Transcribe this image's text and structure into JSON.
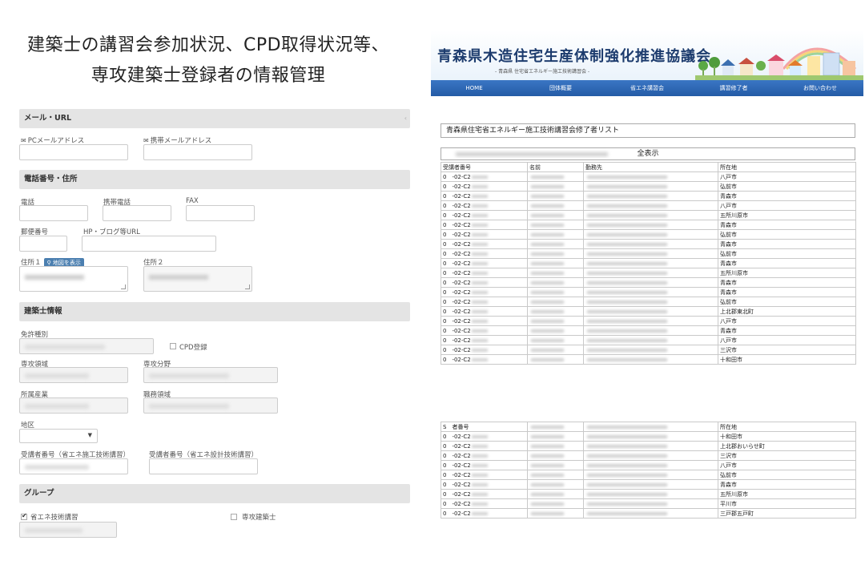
{
  "headline": {
    "line1": "建築士の講習会参加状況、CPD取得状況等、",
    "line2": "専攻建築士登録者の情報管理"
  },
  "form": {
    "mail_section": "メール・URL",
    "pc_mail": "PCメールアドレス",
    "mobile_mail": "携帯メールアドレス",
    "phone_section": "電話番号・住所",
    "tel": "電話",
    "mobile_tel": "携帯電話",
    "fax": "FAX",
    "zip": "郵便番号",
    "url": "HP・ブログ等URL",
    "addr1": "住所１",
    "map_badge": "地図を表示",
    "addr2": "住所２",
    "architect_section": "建築士情報",
    "license": "免許種別",
    "cpd": "CPD登録",
    "major_area": "専攻領域",
    "major_field": "専攻分野",
    "industry": "所属産業",
    "job_area": "職務領域",
    "district": "地区",
    "attendee_construction": "受講者番号（省エネ施工技術講習）",
    "attendee_design": "受講者番号（省エネ設計技術講習）",
    "group_section": "グループ",
    "energy_course": "省エネ技術講習",
    "major_architect": "専攻建築士",
    "icons": {
      "mail": "envelope-icon",
      "map": "map-pin-icon",
      "select": "chevron-down-icon"
    }
  },
  "site": {
    "title": "青森県木造住宅生産体制強化推進協議会",
    "subtitle": "- 青森県 住宅省エネルギー施工技術講習会 -",
    "nav": [
      "HOME",
      "団体概要",
      "省エネ講習会",
      "講習修了者",
      "お問い合わせ"
    ],
    "list_title": "青森県住宅省エネルギー施工技術講習会修了者リスト",
    "show_all": "全表示",
    "headers1": [
      "受講者番号",
      "名前",
      "勤務先",
      "所在地"
    ],
    "headers2": [
      "S　者番号",
      "",
      "",
      "所在地"
    ],
    "code": "0　-02-C2",
    "rows1": [
      "八戸市",
      "弘前市",
      "青森市",
      "八戸市",
      "五所川原市",
      "青森市",
      "弘前市",
      "青森市",
      "弘前市",
      "青森市",
      "五所川原市",
      "青森市",
      "青森市",
      "弘前市",
      "上北郡東北町",
      "八戸市",
      "青森市",
      "八戸市",
      "三沢市",
      "十和田市"
    ],
    "rows2": [
      "十和田市",
      "上北郡おいらせ町",
      "三沢市",
      "八戸市",
      "弘前市",
      "青森市",
      "五所川原市",
      "平川市",
      "三戸郡五戸町"
    ],
    "colors": {
      "nav": "#2f69b6",
      "title": "#1d3c6e"
    }
  }
}
